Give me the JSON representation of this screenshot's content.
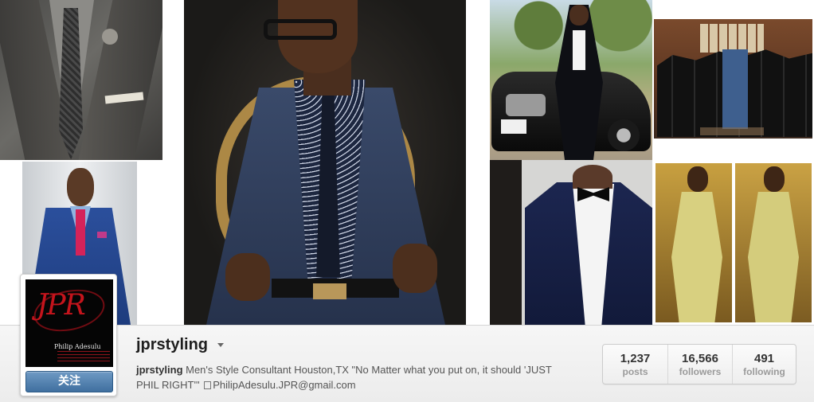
{
  "mosaic": {
    "tiles": [
      {
        "name": "photo-grey-suit-closeup"
      },
      {
        "name": "photo-blue-suit-portrait"
      },
      {
        "name": "photo-glasses-navy-suit"
      },
      {
        "name": "photo-tuxedo-with-car"
      },
      {
        "name": "photo-wedding-groomsmen"
      },
      {
        "name": "photo-navy-tuxedo-mannequin"
      },
      {
        "name": "photo-yellow-suits"
      }
    ]
  },
  "profile": {
    "avatar_logo": "JPR",
    "avatar_name": "Philip Adesulu",
    "follow_label": "关注",
    "username": "jprstyling",
    "bio_name": "jprstyling",
    "bio_text": " Men's Style Consultant Houston,TX \"No Matter what you put on, it should 'JUST PHIL RIGHT'\" ",
    "bio_email": "PhilipAdesulu.JPR@gmail.com"
  },
  "stats": [
    {
      "value": "1,237",
      "label": "posts"
    },
    {
      "value": "16,566",
      "label": "followers"
    },
    {
      "value": "491",
      "label": "following"
    }
  ]
}
